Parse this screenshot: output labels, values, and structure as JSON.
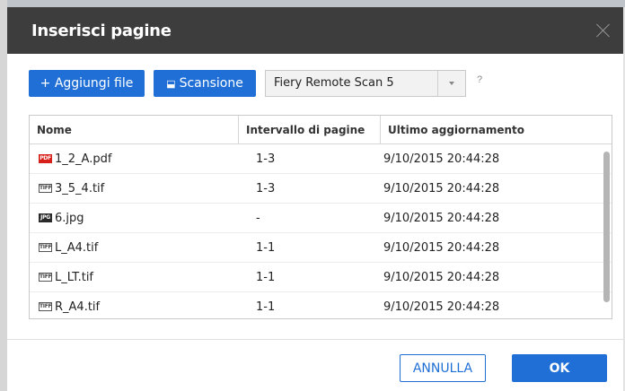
{
  "dialog": {
    "title": "Inserisci pagine"
  },
  "toolbar": {
    "add_label": "+ Aggiungi file",
    "scan_label": "Scansione",
    "scanner_value": "Fiery Remote Scan 5",
    "help_label": "?"
  },
  "table": {
    "headers": [
      "Nome",
      "Intervallo di pagine",
      "Ultimo aggiornamento"
    ],
    "rows": [
      {
        "icon": "pdf-file-icon",
        "badge": "PDF",
        "name": "1_2_A.pdf",
        "range": "1-3",
        "updated": "9/10/2015 20:44:28"
      },
      {
        "icon": "tiff-file-icon",
        "badge": "TIFF",
        "name": "3_5_4.tif",
        "range": "1-3",
        "updated": "9/10/2015 20:44:28"
      },
      {
        "icon": "jpg-file-icon",
        "badge": "JPG",
        "name": "6.jpg",
        "range": "-",
        "updated": "9/10/2015 20:44:28"
      },
      {
        "icon": "tiff-file-icon",
        "badge": "TIFF",
        "name": "L_A4.tif",
        "range": "1-1",
        "updated": "9/10/2015 20:44:28"
      },
      {
        "icon": "tiff-file-icon",
        "badge": "TIFF",
        "name": "L_LT.tif",
        "range": "1-1",
        "updated": "9/10/2015 20:44:28"
      },
      {
        "icon": "tiff-file-icon",
        "badge": "TIFF",
        "name": "R_A4.tif",
        "range": "1-1",
        "updated": "9/10/2015 20:44:28"
      }
    ]
  },
  "footer": {
    "cancel_label": "ANNULLA",
    "ok_label": "OK"
  },
  "colors": {
    "accent": "#1f6fd6",
    "titlebar": "#3d3d3d",
    "pdf_badge": "#d8201b"
  }
}
